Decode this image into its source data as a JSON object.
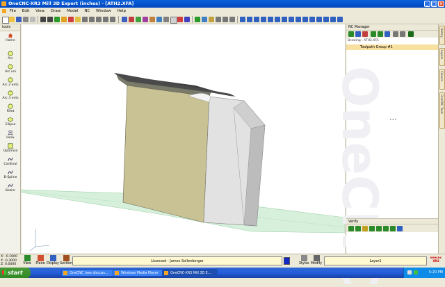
{
  "window": {
    "title": "OneCNC-XR3 Mill 3D Expert (inches) - [ATH2.XFA]",
    "min_label": "_",
    "max_label": "□",
    "close_label": "×"
  },
  "menu": [
    "File",
    "Edit",
    "View",
    "Draw",
    "Model",
    "NC",
    "Window",
    "Help"
  ],
  "toolpanel": {
    "header": "tools",
    "tools": [
      "Home",
      "Arc",
      "Arc uni",
      "Arc 2 ents",
      "Arc 3 ents",
      "Fillet",
      "Ellipse",
      "Helix",
      "Optimize",
      "Cardinal",
      "B-Spline",
      "Bezier"
    ]
  },
  "nc_manager": {
    "title": "NC Manager",
    "drawing_label": "Drawing : ATH2.XFA",
    "group_label": "Toolpath Group #1",
    "watermark": "OneCNC",
    "divider": "•••"
  },
  "verify": {
    "title": "Verify"
  },
  "side_tabs": [
    "History",
    "Layers",
    "Colours",
    "OneCNC Tools"
  ],
  "status": {
    "coords": [
      "X: -0.1000",
      "Y: -0.3000",
      "Z: 0.0000"
    ],
    "view_buttons": [
      "View",
      "Plane",
      "Display",
      "Section"
    ],
    "license": "Licensed - James Sollenberger",
    "style_buttons": [
      "Styles",
      "Modify"
    ],
    "layer": "Layer1",
    "logo_top": "onecnc",
    "logo_bottom": "XR3"
  },
  "taskbar": {
    "start_label": "start",
    "tasks": [
      "OneCNC (see discuss...",
      "Windows Media Player",
      "OneCNC-XR3 Mill 3D E..."
    ],
    "clock": "5:20 PM"
  },
  "colors": {
    "titlebar": "#0046c0",
    "part_front": "#c8c294",
    "part_side": "#e2e2e2",
    "part_top": "#4a4a4a",
    "plane": "#d6f0dc",
    "license_bg": "#fff8d0",
    "color_swatch": "#1428c8",
    "group_highlight": "#f7e0a0"
  }
}
